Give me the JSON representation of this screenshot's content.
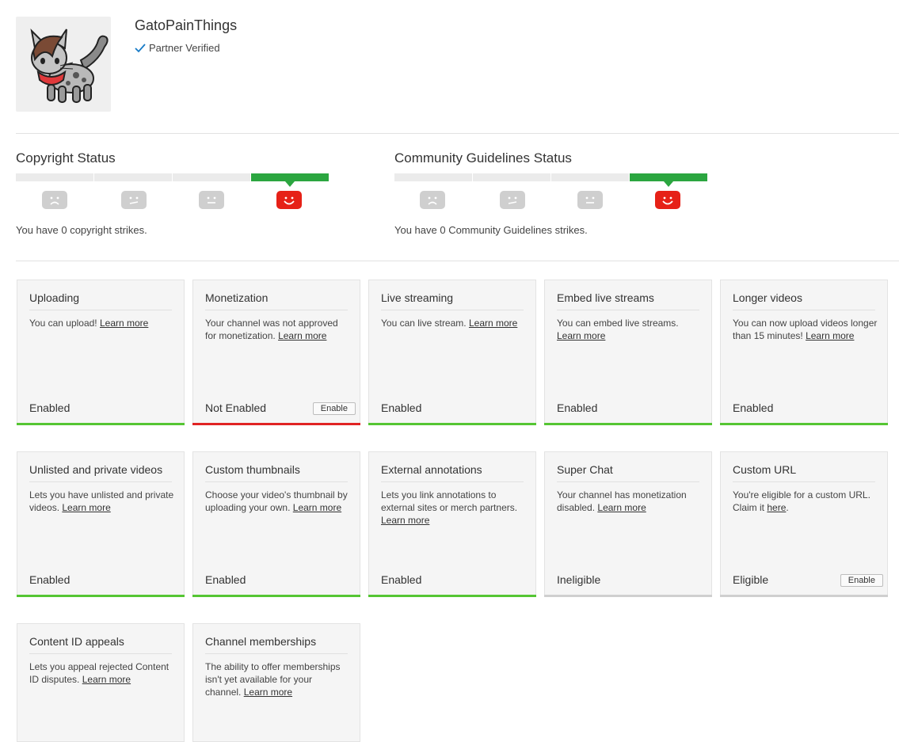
{
  "channel": {
    "name": "GatoPainThings",
    "verified_label": "Partner Verified"
  },
  "copyright": {
    "title": "Copyright Status",
    "strikes_text": "You have 0 copyright strikes."
  },
  "community": {
    "title": "Community Guidelines Status",
    "strikes_text": "You have 0 Community Guidelines strikes."
  },
  "features": [
    {
      "title": "Uploading",
      "desc": "You can upload!",
      "link": "Learn more",
      "status": "Enabled",
      "color": "green"
    },
    {
      "title": "Monetization",
      "desc": "Your channel was not approved for monetization.",
      "link": "Learn more",
      "status": "Not Enabled",
      "color": "red",
      "button": "Enable"
    },
    {
      "title": "Live streaming",
      "desc": "You can live stream.",
      "link": "Learn more",
      "status": "Enabled",
      "color": "green"
    },
    {
      "title": "Embed live streams",
      "desc": "You can embed live streams.",
      "link": "Learn more",
      "status": "Enabled",
      "color": "green"
    },
    {
      "title": "Longer videos",
      "desc": "You can now upload videos longer than 15 minutes!",
      "link": "Learn more",
      "status": "Enabled",
      "color": "green"
    },
    {
      "title": "Unlisted and private videos",
      "desc": "Lets you have unlisted and private videos.",
      "link": "Learn more",
      "status": "Enabled",
      "color": "green"
    },
    {
      "title": "Custom thumbnails",
      "desc": "Choose your video's thumbnail by uploading your own.",
      "link": "Learn more",
      "status": "Enabled",
      "color": "green"
    },
    {
      "title": "External annotations",
      "desc": "Lets you link annotations to external sites or merch partners.",
      "link": "Learn more",
      "status": "Enabled",
      "color": "green"
    },
    {
      "title": "Super Chat",
      "desc": "Your channel has monetization disabled.",
      "link": "Learn more",
      "status": "Ineligible",
      "color": "grey"
    },
    {
      "title": "Custom URL",
      "desc": "You're eligible for a custom URL. Claim it",
      "link": "here",
      "suffix": ".",
      "status": "Eligible",
      "color": "grey",
      "button": "Enable"
    },
    {
      "title": "Content ID appeals",
      "desc": "Lets you appeal rejected Content ID disputes.",
      "link": "Learn more",
      "status": "",
      "color": "none"
    },
    {
      "title": "Channel memberships",
      "desc": "The ability to offer memberships isn't yet available for your channel.",
      "link": "Learn more",
      "status": "",
      "color": "none"
    }
  ],
  "colors": {
    "accent_green": "#2ba640",
    "enabled_bar": "#55c533",
    "disabled_bar": "#e02323",
    "neutral_bar": "#cfcfcf",
    "happy_face": "#e62117",
    "check": "#167ac6"
  }
}
